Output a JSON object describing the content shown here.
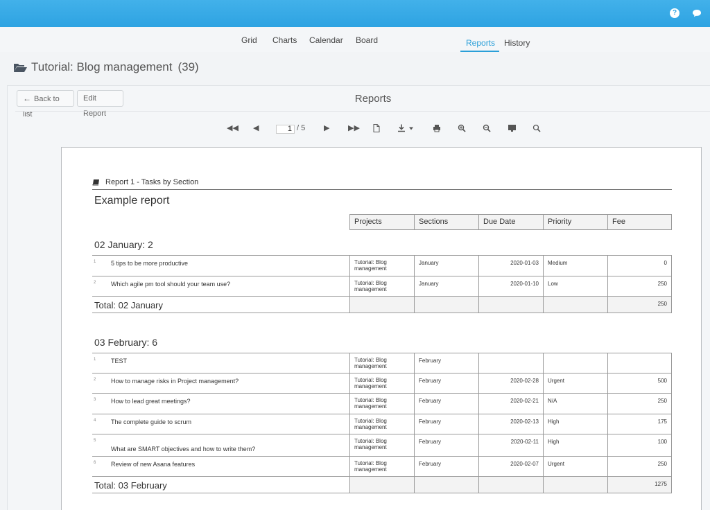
{
  "header": {
    "help_icon": "question-circle-icon",
    "chat_icon": "chat-bubble-icon",
    "help_glyph": "?"
  },
  "tabs": [
    {
      "label": "Grid"
    },
    {
      "label": "Charts"
    },
    {
      "label": "Calendar"
    },
    {
      "label": "Board"
    },
    {
      "label": "Reports",
      "active": true
    },
    {
      "label": "History"
    }
  ],
  "project": {
    "title": "Tutorial: Blog management",
    "count": "(39)"
  },
  "panel": {
    "back_label": "Back to list",
    "edit_label": "Edit Report",
    "title": "Reports"
  },
  "viewer": {
    "page_current": "1",
    "page_total": "/ 5"
  },
  "report": {
    "heading": "Report 1 - Tasks by Section",
    "title": "Example report",
    "columns": [
      "Projects",
      "Sections",
      "Due Date",
      "Priority",
      "Fee"
    ],
    "groups": [
      {
        "title": "02 January: 2",
        "rows": [
          {
            "idx": "1",
            "task": "5 tips to be more productive",
            "project": "Tutorial: Blog management",
            "section": "January",
            "due": "2020-01-03",
            "priority": "Medium",
            "fee": "0"
          },
          {
            "idx": "2",
            "task": "Which agile pm tool should your team use?",
            "project": "Tutorial: Blog management",
            "section": "January",
            "due": "2020-01-10",
            "priority": "Low",
            "fee": "250"
          }
        ],
        "total_label": "Total: 02 January",
        "total_fee": "250"
      },
      {
        "title": "03 February: 6",
        "rows": [
          {
            "idx": "1",
            "task": "TEST",
            "project": "Tutorial: Blog management",
            "section": "February",
            "due": "",
            "priority": "",
            "fee": ""
          },
          {
            "idx": "2",
            "task": "How to manage risks in Project management?",
            "project": "Tutorial: Blog management",
            "section": "February",
            "due": "2020-02-28",
            "priority": "Urgent",
            "fee": "500"
          },
          {
            "idx": "3",
            "task": "How to lead great meetings?",
            "project": "Tutorial: Blog management",
            "section": "February",
            "due": "2020-02-21",
            "priority": "N/A",
            "fee": "250"
          },
          {
            "idx": "4",
            "task": "The complete guide to scrum",
            "project": "Tutorial: Blog management",
            "section": "February",
            "due": "2020-02-13",
            "priority": "High",
            "fee": "175"
          },
          {
            "idx": "5",
            "task": "What are SMART objectives and how to write them?",
            "project": "Tutorial: Blog management",
            "section": "February",
            "due": "2020-02-11",
            "priority": "High",
            "fee": "100"
          },
          {
            "idx": "6",
            "task": "Review of new Asana features",
            "project": "Tutorial: Blog management",
            "section": "February",
            "due": "2020-02-07",
            "priority": "Urgent",
            "fee": "250"
          }
        ],
        "total_label": "Total: 03 February",
        "total_fee": "1275"
      }
    ]
  }
}
